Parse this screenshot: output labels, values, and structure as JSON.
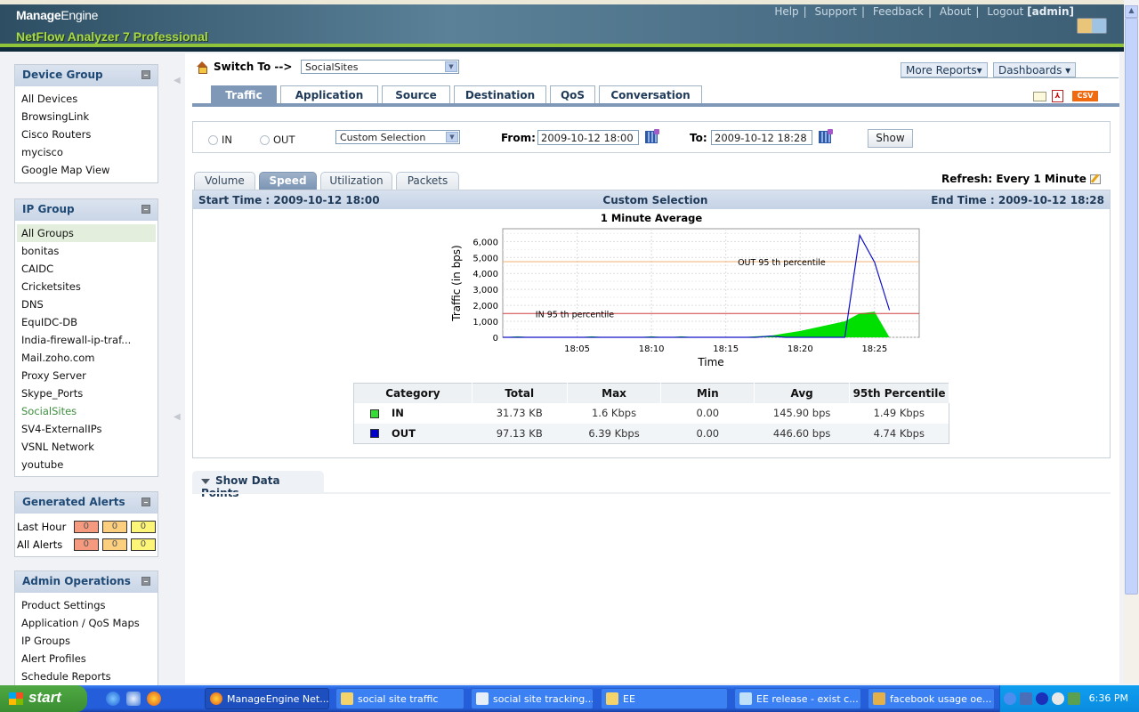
{
  "header": {
    "brand": "Manage",
    "brand_light": "Engine",
    "product": "NetFlow Analyzer 7 Professional",
    "links": [
      "Help",
      "Support",
      "Feedback",
      "About",
      "Logout"
    ],
    "user": "[admin]"
  },
  "sidebar": {
    "device_group": {
      "title": "Device Group",
      "items": [
        "All Devices",
        "BrowsingLink",
        "Cisco Routers",
        "mycisco",
        "Google Map View"
      ]
    },
    "ip_group": {
      "title": "IP Group",
      "items": [
        "All Groups",
        "bonitas",
        "CAIDC",
        "Cricketsites",
        "DNS",
        "EquIDC-DB",
        "India-firewall-ip-traf...",
        "Mail.zoho.com",
        "Proxy Server",
        "Skype_Ports",
        "SocialSites",
        "SV4-ExternalIPs",
        "VSNL Network",
        "youtube"
      ],
      "highlighted": "All Groups",
      "current": "SocialSites"
    },
    "alerts": {
      "title": "Generated Alerts",
      "rows": [
        {
          "label": "Last Hour",
          "critical": "0",
          "major": "0",
          "minor": "0"
        },
        {
          "label": "All Alerts",
          "critical": "0",
          "major": "0",
          "minor": "0"
        }
      ],
      "colors": {
        "critical": "#f59a7e",
        "major": "#fbcf7e",
        "minor": "#fdf578"
      }
    },
    "admin": {
      "title": "Admin Operations",
      "items": [
        "Product Settings",
        "Application / QoS Maps",
        "IP Groups",
        "Alert Profiles",
        "Schedule Reports"
      ]
    }
  },
  "main": {
    "switch_label": "Switch To -->",
    "switch_value": "SocialSites",
    "more_reports": "More Reports",
    "dashboards": "Dashboards",
    "tabs": [
      "Traffic",
      "Application",
      "Source",
      "Destination",
      "QoS",
      "Conversation"
    ],
    "active_tab": "Traffic",
    "export": {
      "csv": "CSV",
      "pdf": "PDF"
    },
    "filter": {
      "in_label": "IN",
      "out_label": "OUT",
      "period": "Custom Selection",
      "from_label": "From:",
      "from_value": "2009-10-12 18:00",
      "to_label": "To:",
      "to_value": "2009-10-12 18:28",
      "show": "Show"
    },
    "subtabs": [
      "Volume",
      "Speed",
      "Utilization",
      "Packets"
    ],
    "active_subtab": "Speed",
    "refresh": "Refresh: Every 1 Minute",
    "start_time": "Start Time : 2009-10-12 18:00",
    "selection": "Custom Selection",
    "end_time": "End Time : 2009-10-12 18:28",
    "show_data_points": "Show Data Points"
  },
  "chart_data": {
    "type": "area",
    "title": "1 Minute Average",
    "xlabel": "Time",
    "ylabel": "Traffic (in bps)",
    "ylim": [
      0,
      6800
    ],
    "xlim": [
      "18:00",
      "18:28"
    ],
    "yticks": [
      0,
      1000,
      2000,
      3000,
      4000,
      5000,
      6000
    ],
    "ytick_labels": [
      "0",
      "1,000",
      "2,000",
      "3,000",
      "4,000",
      "5,000",
      "6,000"
    ],
    "xticks_min": [
      5,
      10,
      15,
      20,
      25
    ],
    "xtick_labels": [
      "18:05",
      "18:10",
      "18:15",
      "18:20",
      "18:25"
    ],
    "grid": true,
    "series": [
      {
        "name": "IN",
        "color": "#00e000",
        "style": "area",
        "x_min": [
          0,
          1,
          2,
          3,
          4,
          5,
          6,
          7,
          8,
          9,
          10,
          11,
          12,
          13,
          14,
          15,
          16,
          17,
          18,
          19,
          20,
          21,
          22,
          23,
          24,
          25,
          26
        ],
        "values": [
          0,
          60,
          0,
          0,
          0,
          0,
          60,
          0,
          0,
          0,
          60,
          0,
          60,
          0,
          0,
          0,
          0,
          60,
          100,
          250,
          400,
          600,
          800,
          1000,
          1500,
          1600,
          0
        ]
      },
      {
        "name": "OUT",
        "color": "#1010c8",
        "style": "line",
        "x_min": [
          0,
          1,
          2,
          3,
          4,
          5,
          6,
          7,
          8,
          9,
          10,
          11,
          12,
          13,
          14,
          15,
          16,
          17,
          18,
          19,
          20,
          21,
          22,
          23,
          24,
          25,
          26
        ],
        "values": [
          0,
          0,
          0,
          0,
          0,
          0,
          0,
          0,
          0,
          0,
          0,
          0,
          0,
          0,
          0,
          0,
          0,
          0,
          80,
          0,
          0,
          0,
          0,
          0,
          6390,
          4700,
          1700
        ]
      }
    ],
    "reference_lines": [
      {
        "label": "IN 95 th percentile",
        "value": 1490,
        "color": "#d04040"
      },
      {
        "label": "OUT 95 th percentile",
        "value": 4740,
        "color": "#f0b070"
      }
    ]
  },
  "stats": {
    "headers": [
      "Category",
      "Total",
      "Max",
      "Min",
      "Avg",
      "95th Percentile"
    ],
    "rows": [
      {
        "category": "IN",
        "color": "#33dd33",
        "total": "31.73 KB",
        "max": "1.6 Kbps",
        "min": "0.00",
        "avg": "145.90 bps",
        "p95": "1.49 Kbps"
      },
      {
        "category": "OUT",
        "color": "#0000cc",
        "total": "97.13 KB",
        "max": "6.39 Kbps",
        "min": "0.00",
        "avg": "446.60 bps",
        "p95": "4.74 Kbps"
      }
    ]
  },
  "taskbar": {
    "start": "start",
    "windows": [
      "ManageEngine Net...",
      "social site traffic",
      "social site tracking....",
      "EE",
      "EE release - exist c...",
      "facebook usage oe..."
    ],
    "active_window": "ManageEngine Net...",
    "clock": "6:36 PM"
  }
}
